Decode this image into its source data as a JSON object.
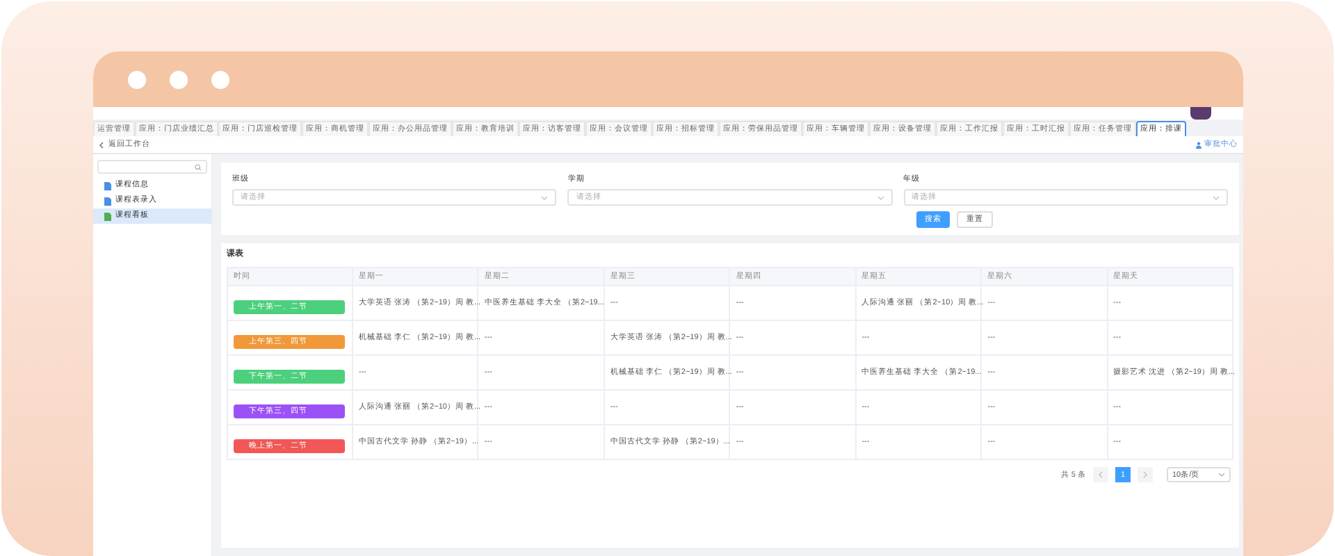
{
  "tabs": [
    {
      "label": "运营管理",
      "selected": false
    },
    {
      "label": "应用：门店业绩汇总",
      "selected": false
    },
    {
      "label": "应用：门店巡检管理",
      "selected": false
    },
    {
      "label": "应用：商机管理",
      "selected": false
    },
    {
      "label": "应用：办公用品管理",
      "selected": false
    },
    {
      "label": "应用：教育培训",
      "selected": false
    },
    {
      "label": "应用：访客管理",
      "selected": false
    },
    {
      "label": "应用：会议管理",
      "selected": false
    },
    {
      "label": "应用：招标管理",
      "selected": false
    },
    {
      "label": "应用：劳保用品管理",
      "selected": false
    },
    {
      "label": "应用：车辆管理",
      "selected": false
    },
    {
      "label": "应用：设备管理",
      "selected": false
    },
    {
      "label": "应用：工作汇报",
      "selected": false
    },
    {
      "label": "应用：工时汇报",
      "selected": false
    },
    {
      "label": "应用：任务管理",
      "selected": false
    },
    {
      "label": "应用：排课",
      "selected": true
    }
  ],
  "breadcrumb": {
    "back": "返回工作台",
    "right_link": "审批中心"
  },
  "sidebar": {
    "items": [
      {
        "label": "课程信息",
        "selected": false
      },
      {
        "label": "课程表录入",
        "selected": false
      },
      {
        "label": "课程看板",
        "selected": true
      }
    ]
  },
  "filters": [
    {
      "label": "班级",
      "placeholder": "请选择"
    },
    {
      "label": "学期",
      "placeholder": "请选择"
    },
    {
      "label": "年级",
      "placeholder": "请选择"
    }
  ],
  "buttons": [
    {
      "label": "搜索",
      "kind": "primary"
    },
    {
      "label": "重置",
      "kind": "default"
    }
  ],
  "table": {
    "title": "课表",
    "columns": [
      "时间",
      "星期一",
      "星期二",
      "星期三",
      "星期四",
      "星期五",
      "星期六",
      "星期天"
    ],
    "rows": [
      {
        "color": "#4cd07d",
        "cells": [
          "上午第一、二节",
          "大学英语 张涛 （第2~19）周 教...",
          "中医养生基础 李大全 （第2~19...",
          "---",
          "---",
          "人际沟通 张丽 （第2~10）周 教...",
          "---",
          "---"
        ]
      },
      {
        "color": "#f0983a",
        "cells": [
          "上午第三、四节",
          "机械基础 李仁 （第2~19）周 教...",
          "---",
          "大学英语 张涛 （第2~19）周 教...",
          "---",
          "---",
          "---",
          "---"
        ]
      },
      {
        "color": "#4cd07d",
        "cells": [
          "下午第一、二节",
          "---",
          "---",
          "机械基础 李仁 （第2~19）周 教...",
          "---",
          "中医养生基础 李大全 （第2~19...",
          "---",
          "摄影艺术 沈进 （第2~19）周 教..."
        ]
      },
      {
        "color": "#9b51f5",
        "cells": [
          "下午第三、四节",
          "人际沟通 张丽 （第2~10）周 教...",
          "---",
          "---",
          "---",
          "---",
          "---",
          "---"
        ]
      },
      {
        "color": "#f25757",
        "cells": [
          "晚上第一、二节",
          "中国古代文学 孙静 （第2~19）...",
          "---",
          "中国古代文学 孙静 （第2~19）...",
          "---",
          "---",
          "---",
          "---"
        ]
      }
    ]
  },
  "pagination": {
    "total": "共 5 条",
    "pages": [
      {
        "label": "1",
        "selected": true
      }
    ],
    "page_size": "10条/页"
  }
}
